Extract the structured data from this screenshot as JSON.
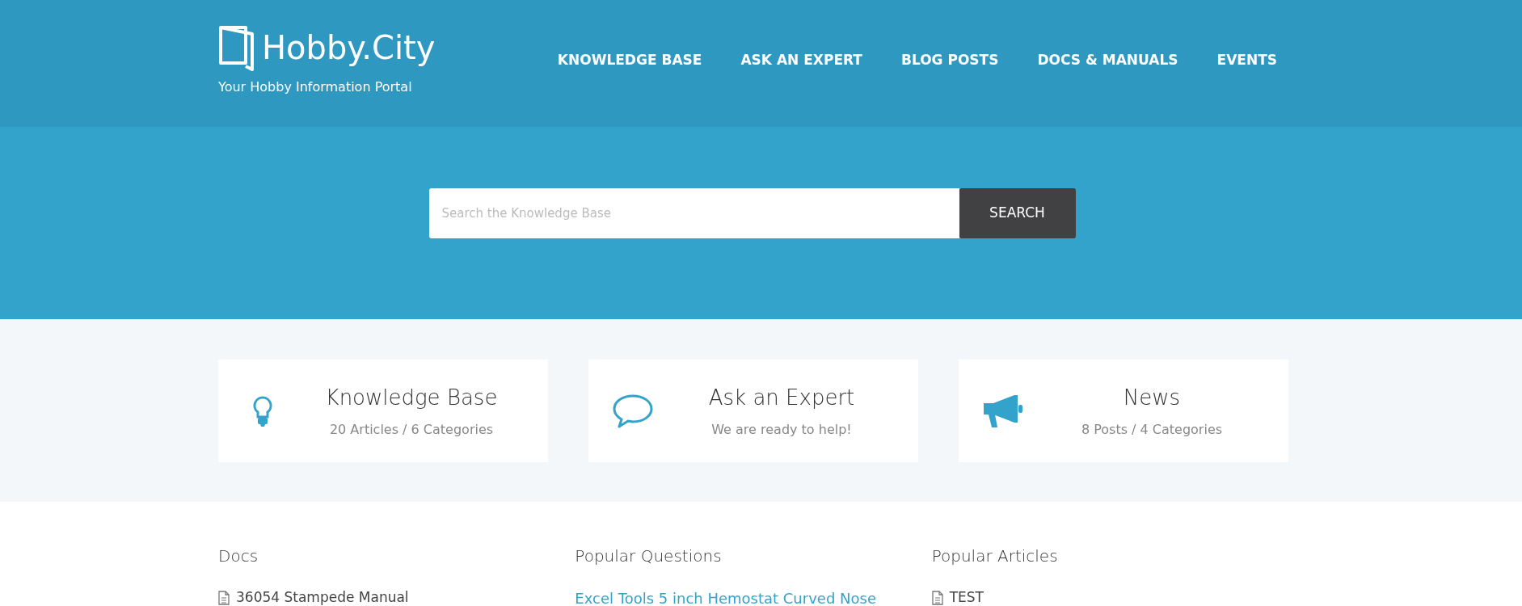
{
  "logo": {
    "title": "Hobby.City",
    "tagline": "Your Hobby Information Portal"
  },
  "nav": [
    {
      "label": "KNOWLEDGE BASE"
    },
    {
      "label": "ASK AN EXPERT"
    },
    {
      "label": "BLOG POSTS"
    },
    {
      "label": "DOCS & MANUALS"
    },
    {
      "label": "EVENTS"
    }
  ],
  "search": {
    "placeholder": "Search the Knowledge Base",
    "button": "SEARCH"
  },
  "cards": [
    {
      "kind": "bulb",
      "title": "Knowledge Base",
      "subtitle": "20 Articles / 6 Categories"
    },
    {
      "kind": "chat",
      "title": "Ask an Expert",
      "subtitle": "We are ready to help!"
    },
    {
      "kind": "megaphone",
      "title": "News",
      "subtitle": "8 Posts / 4 Categories"
    }
  ],
  "sections": [
    {
      "title": "Docs",
      "items": [
        {
          "kind": "doc",
          "label": "36054 Stampede Manual"
        }
      ]
    },
    {
      "title": "Popular Questions",
      "items": [
        {
          "kind": "link",
          "label": "Excel Tools 5 inch Hemostat Curved Nose"
        }
      ]
    },
    {
      "title": "Popular Articles",
      "items": [
        {
          "kind": "doc",
          "label": "TEST"
        }
      ]
    }
  ]
}
